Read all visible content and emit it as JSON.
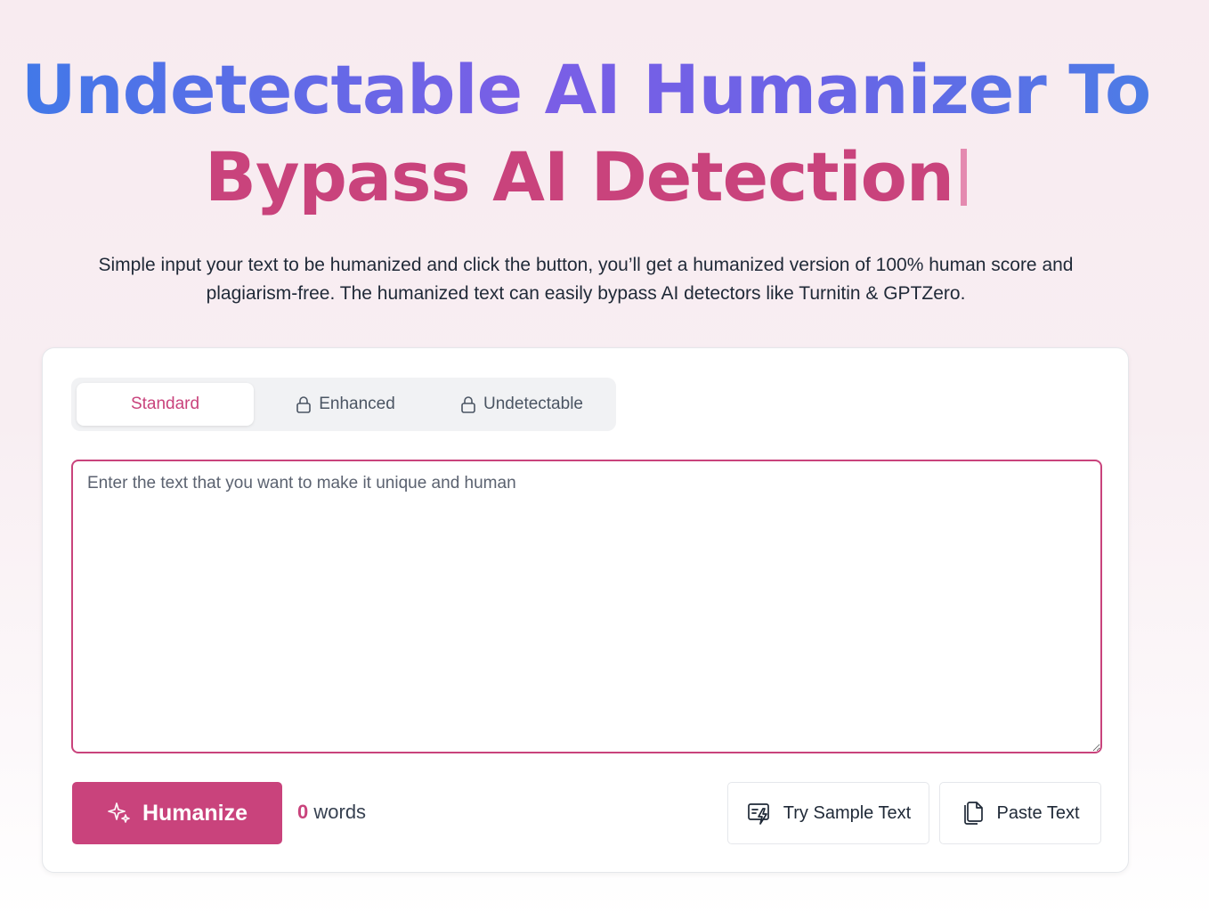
{
  "hero": {
    "title_line1": "Undetectable AI Humanizer To",
    "title_line2": "Bypass AI Detection",
    "subtitle": "Simple input your text to be humanized and click the button, you’ll get a humanized version of 100% human score and plagiarism-free. The humanized text can easily bypass AI detectors like Turnitin & GPTZero."
  },
  "modes": {
    "tabs": [
      {
        "label": "Standard",
        "locked": false,
        "active": true
      },
      {
        "label": "Enhanced",
        "locked": true,
        "icon": "lock-icon"
      },
      {
        "label": "Undetectable",
        "locked": true,
        "icon": "lock-icon"
      }
    ]
  },
  "editor": {
    "placeholder": "Enter the text that you want to make it unique and human",
    "value": ""
  },
  "actions": {
    "humanize_label": "Humanize",
    "humanize_icon": "sparkles-icon",
    "word_count": "0",
    "word_unit": "words",
    "sample_label": "Try Sample Text",
    "sample_icon": "sample-text-icon",
    "paste_label": "Paste Text",
    "paste_icon": "copy-icon"
  },
  "colors": {
    "accent": "#c9437c",
    "title_blue": "#3f7ae8",
    "title_purple": "#7b5ee6"
  }
}
